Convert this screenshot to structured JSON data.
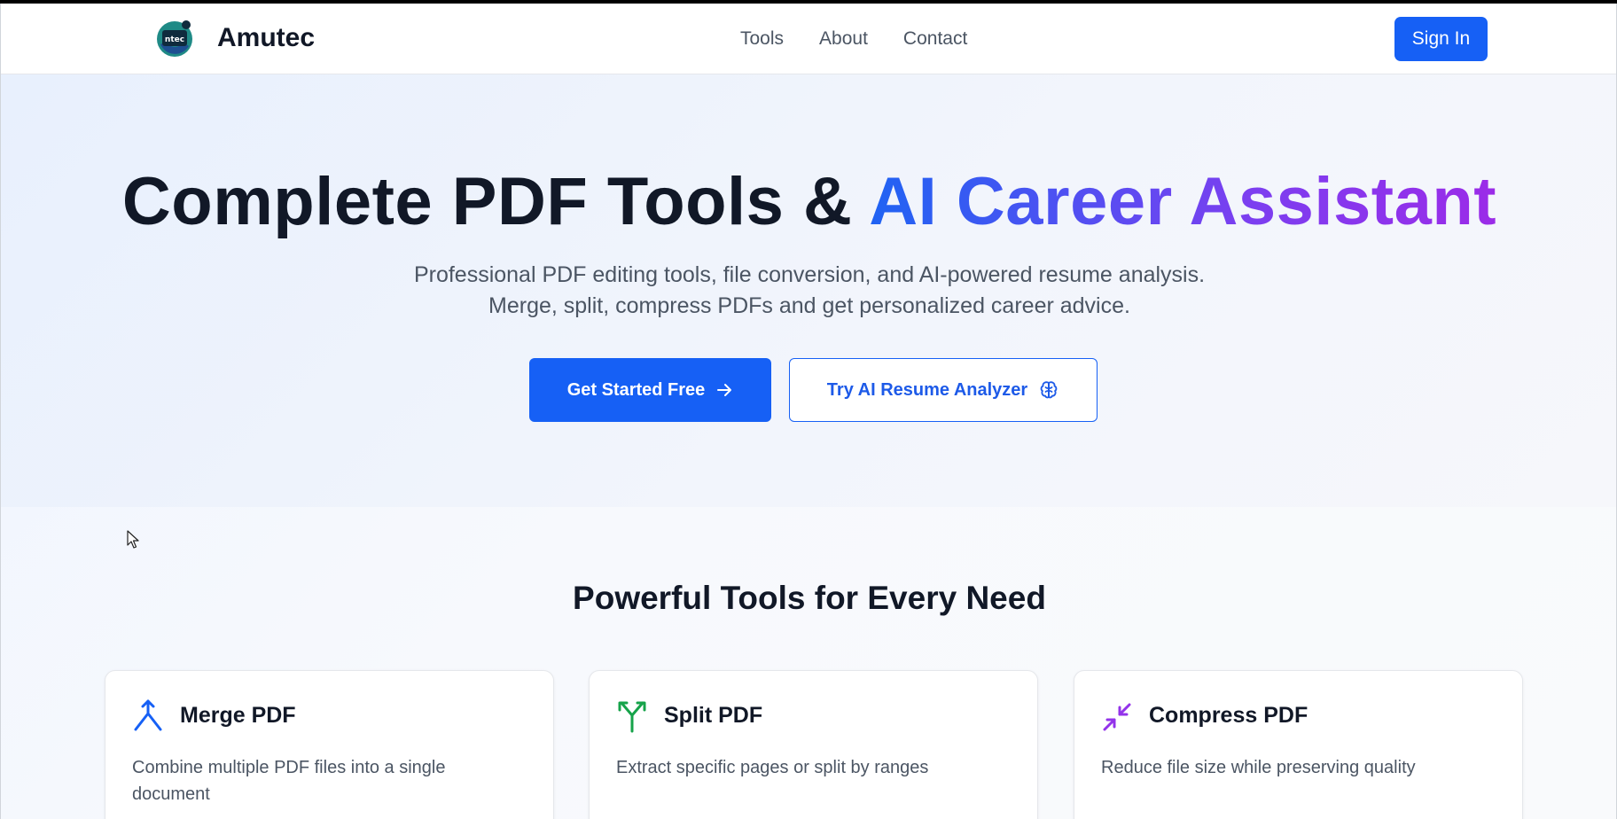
{
  "header": {
    "brand": "Amutec",
    "logo_text": "ntec",
    "nav": [
      "Tools",
      "About",
      "Contact"
    ],
    "sign_in": "Sign In"
  },
  "hero": {
    "title_plain": "Complete PDF Tools & ",
    "title_accent": "AI Career Assistant",
    "subtitle_line1": "Professional PDF editing tools, file conversion, and AI-powered resume analysis.",
    "subtitle_line2": "Merge, split, compress PDFs and get personalized career advice.",
    "primary_button": "Get Started Free",
    "secondary_button": "Try AI Resume Analyzer"
  },
  "tools": {
    "title": "Powerful Tools for Every Need",
    "cards": [
      {
        "title": "Merge PDF",
        "desc": "Combine multiple PDF files into a single document",
        "icon": "merge-icon",
        "color": "#1660f5"
      },
      {
        "title": "Split PDF",
        "desc": "Extract specific pages or split by ranges",
        "icon": "split-icon",
        "color": "#16a34a"
      },
      {
        "title": "Compress PDF",
        "desc": "Reduce file size while preserving quality",
        "icon": "compress-icon",
        "color": "#9333ea"
      }
    ]
  },
  "colors": {
    "primary": "#1660f5",
    "gradient_start": "#1f63f3",
    "gradient_end": "#9b2be8"
  }
}
